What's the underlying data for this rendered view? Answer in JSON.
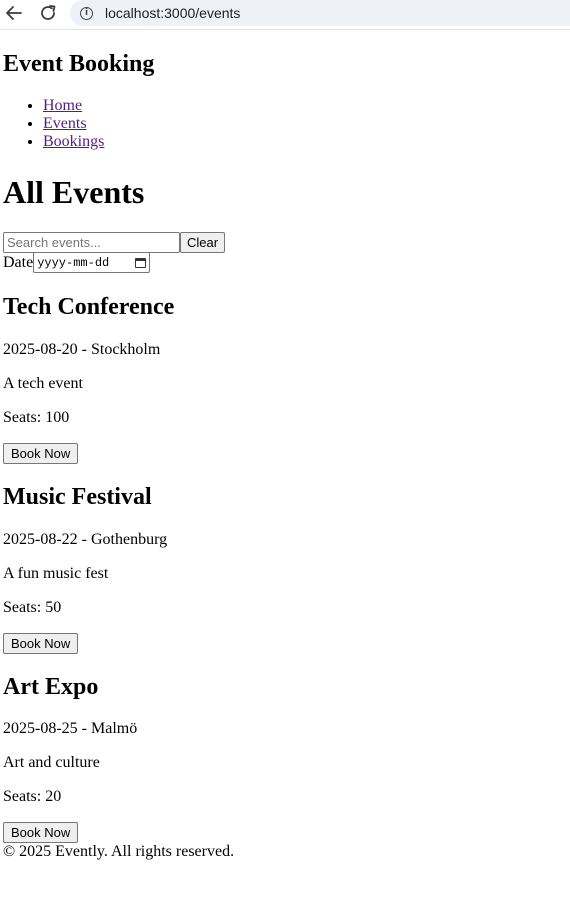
{
  "browser": {
    "url": "localhost:3000/events"
  },
  "header": {
    "site_title": "Event Booking",
    "nav": [
      {
        "label": "Home"
      },
      {
        "label": "Events"
      },
      {
        "label": "Bookings"
      }
    ]
  },
  "main": {
    "title": "All Events",
    "search": {
      "placeholder": "Search events...",
      "value": "",
      "clear_label": "Clear"
    },
    "date_filter": {
      "label": "Date",
      "placeholder": "yyyy-mm-dd"
    },
    "events": [
      {
        "name": "Tech Conference",
        "date_location": "2025-08-20 - Stockholm",
        "description": "A tech event",
        "seats": "Seats: 100",
        "button": "Book Now"
      },
      {
        "name": "Music Festival",
        "date_location": "2025-08-22 - Gothenburg",
        "description": "A fun music fest",
        "seats": "Seats: 50",
        "button": "Book Now"
      },
      {
        "name": "Art Expo",
        "date_location": "2025-08-25 - Malmö",
        "description": "Art and culture",
        "seats": "Seats: 20",
        "button": "Book Now"
      }
    ]
  },
  "footer": {
    "text": "© 2025 Evently. All rights reserved."
  },
  "colors": {
    "visited_link": "#551a8b",
    "address_bar_bg": "#eef1f6"
  }
}
